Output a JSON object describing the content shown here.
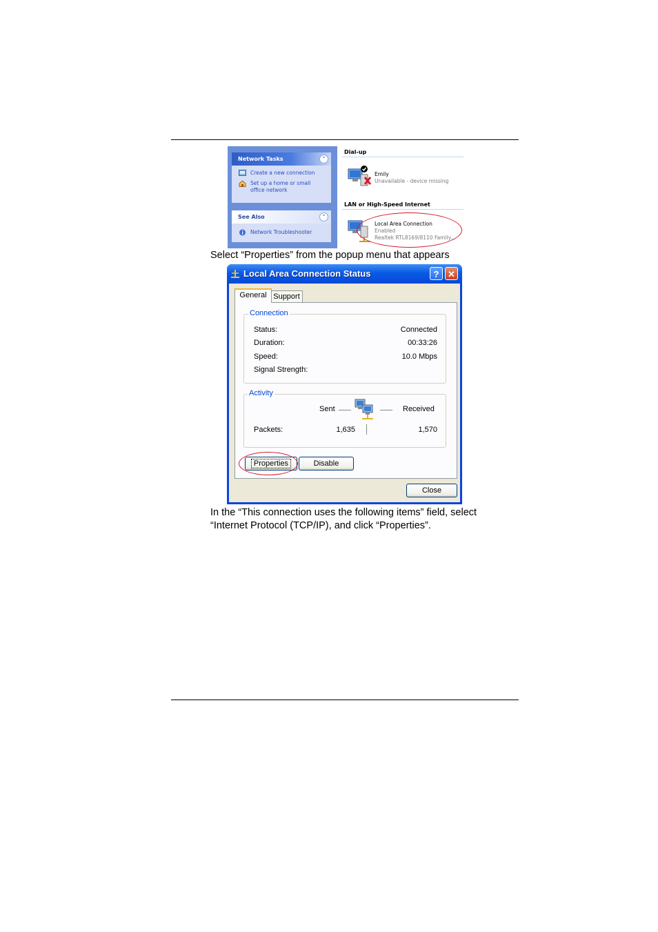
{
  "network_window": {
    "network_tasks_header": "Network Tasks",
    "tasks": [
      "Create a new connection",
      "Set up a home or small",
      "office network"
    ],
    "see_also_header": "See Also",
    "see_also_items": [
      "Network Troubleshooter"
    ],
    "dialup_header": "Dial-up",
    "dialup_connection": {
      "name": "Emily",
      "status": "Unavailable - device missing"
    },
    "lan_header": "LAN or High-Speed Internet",
    "lan_connection": {
      "name": "Local Area Connection",
      "status": "Enabled",
      "device": "Realtek RTL8169/8110 Family..."
    }
  },
  "caption_1": "Select “Properties” from the popup menu that appears",
  "status_dialog": {
    "title": "Local Area Connection Status",
    "help_glyph": "?",
    "close_glyph": "✕",
    "tabs": [
      "General",
      "Support"
    ],
    "connection_group": "Connection",
    "rows": [
      {
        "label": "Status:",
        "value": "Connected"
      },
      {
        "label": "Duration:",
        "value": "00:33:26"
      },
      {
        "label": "Speed:",
        "value": "10.0 Mbps"
      },
      {
        "label": "Signal Strength:",
        "value": ""
      }
    ],
    "activity_group": "Activity",
    "sent_label": "Sent",
    "received_label": "Received",
    "packets_label": "Packets:",
    "packets_sent": "1,635",
    "packets_received": "1,570",
    "properties_button": "Properties",
    "disable_button": "Disable",
    "close_button": "Close",
    "highlight_color": "#d7182a"
  },
  "caption_2_line1": "In the “This connection uses the following items” field, select",
  "caption_2_line2": "“Internet Protocol (TCP/IP), and click “Properties”."
}
